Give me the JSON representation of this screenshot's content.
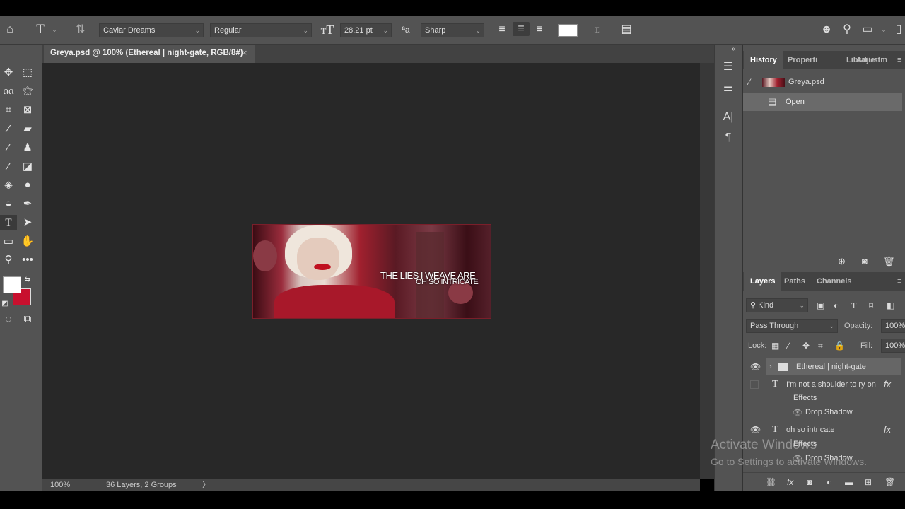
{
  "options_bar": {
    "font_family": "Caviar Dreams",
    "font_style": "Regular",
    "font_size": "28.21 pt",
    "antialias": "Sharp",
    "text_color": "#ffffff"
  },
  "document": {
    "tab_title": "Greya.psd @ 100% (Ethereal | night-gate, RGB/8#)",
    "close": "×",
    "artwork_line1": "The lies I weave are",
    "artwork_line2": "oh so intricate"
  },
  "status": {
    "zoom": "100%",
    "info": "36 Layers, 2 Groups",
    "arrow": "〉"
  },
  "colors": {
    "foreground": "#ffffff",
    "background": "#c8102e"
  },
  "history_panel": {
    "tabs": [
      "History",
      "Properti",
      "Librarie:",
      "Adjustm"
    ],
    "snapshot": "Greya.psd",
    "states": [
      "Open"
    ]
  },
  "layers_panel": {
    "tabs": [
      "Layers",
      "Paths",
      "Channels"
    ],
    "filter": "Kind",
    "blend_mode": "Pass Through",
    "opacity_label": "Opacity:",
    "opacity": "100%",
    "lock_label": "Lock:",
    "fill_label": "Fill:",
    "fill": "100%",
    "layers": [
      {
        "name": "Ethereal | night-gate",
        "type": "group"
      },
      {
        "name": "I'm not a shoulder to  ry on",
        "type": "text",
        "fx": "fx",
        "effects": "Effects",
        "effect": "Drop Shadow"
      },
      {
        "name": "oh so intricate",
        "type": "text",
        "fx": "fx",
        "effects": "Effects",
        "effect": "Drop Shadow"
      }
    ]
  },
  "watermark": {
    "line1": "Activate Windows",
    "line2": "Go to Settings to activate Windows."
  }
}
